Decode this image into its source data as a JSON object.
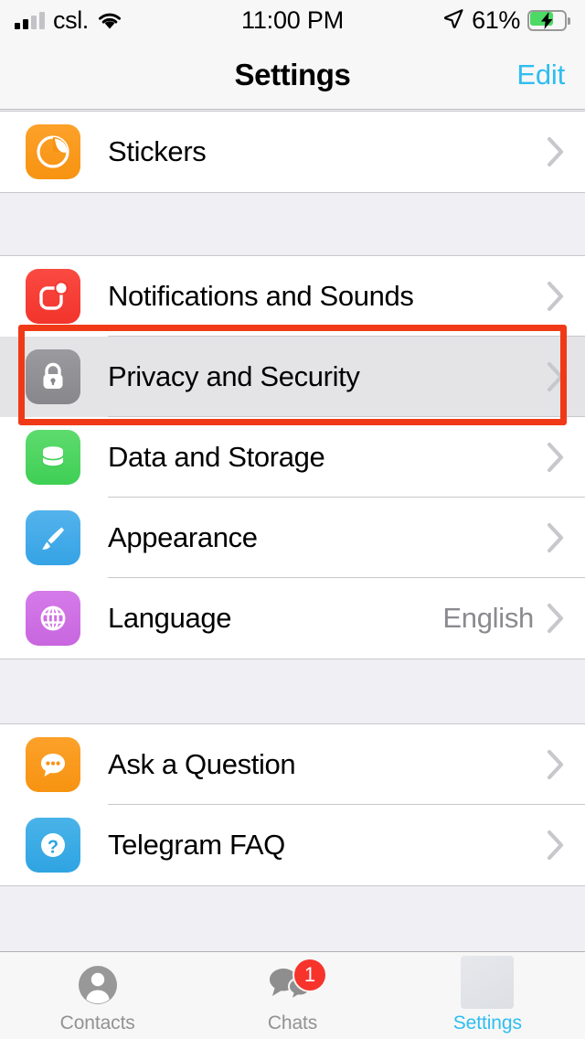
{
  "status_bar": {
    "carrier": "csl.",
    "time": "11:00 PM",
    "battery_percent": "61%",
    "signal_bars_filled": 2,
    "signal_bars_total": 4,
    "wifi_icon": "wifi-icon",
    "location_icon": "location-arrow-icon",
    "battery_icon": "battery-charging-icon"
  },
  "nav": {
    "title": "Settings",
    "edit_label": "Edit",
    "edit_color": "#2EBEEF"
  },
  "sections": [
    {
      "id": "stickers-section",
      "rows": [
        {
          "id": "stickers",
          "label": "Stickers",
          "icon": "sticker-icon",
          "icon_color": "#F79311",
          "value": "",
          "chevron": true
        }
      ]
    },
    {
      "id": "main-settings-section",
      "rows": [
        {
          "id": "notifications-and-sounds",
          "label": "Notifications and Sounds",
          "icon": "bell-notification-icon",
          "icon_color": "#F2342C",
          "value": "",
          "chevron": true
        },
        {
          "id": "privacy-and-security",
          "label": "Privacy and Security",
          "icon": "lock-icon",
          "icon_color": "#87878C",
          "value": "",
          "chevron": true,
          "highlighted": true
        },
        {
          "id": "data-and-storage",
          "label": "Data and Storage",
          "icon": "database-icon",
          "icon_color": "#3FCF55",
          "value": "",
          "chevron": true
        },
        {
          "id": "appearance",
          "label": "Appearance",
          "icon": "paintbrush-icon",
          "icon_color": "#35A3E5",
          "value": "",
          "chevron": true
        },
        {
          "id": "language",
          "label": "Language",
          "icon": "globe-icon",
          "icon_color": "#C866DF",
          "value": "English",
          "chevron": true
        }
      ]
    },
    {
      "id": "help-section",
      "rows": [
        {
          "id": "ask-a-question",
          "label": "Ask a Question",
          "icon": "chat-bubble-icon",
          "icon_color": "#F79311",
          "value": "",
          "chevron": true
        },
        {
          "id": "telegram-faq",
          "label": "Telegram FAQ",
          "icon": "question-mark-icon",
          "icon_color": "#2FA4E2",
          "value": "",
          "chevron": true
        }
      ]
    }
  ],
  "annotation": {
    "target": "privacy-and-security",
    "color": "#F03A17"
  },
  "tab_bar": {
    "items": [
      {
        "id": "contacts",
        "label": "Contacts",
        "icon": "person-icon",
        "active": false,
        "badge": ""
      },
      {
        "id": "chats",
        "label": "Chats",
        "icon": "chat-bubbles-icon",
        "active": false,
        "badge": "1"
      },
      {
        "id": "settings",
        "label": "Settings",
        "icon": "settings-placeholder-icon",
        "active": true,
        "badge": ""
      }
    ],
    "active_color": "#2EBEEF",
    "inactive_color": "#929292",
    "badge_color": "#F6342C"
  }
}
